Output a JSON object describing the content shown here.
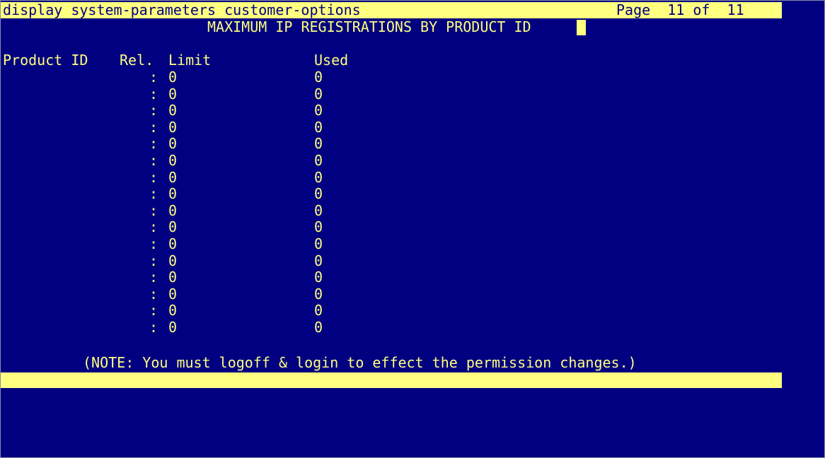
{
  "header": {
    "command": "display system-parameters customer-options",
    "page_label": "Page  11 of  11"
  },
  "form": {
    "title": "MAXIMUM IP REGISTRATIONS BY PRODUCT ID",
    "columns": {
      "product_id": "Product ID",
      "rel": "Rel.",
      "limit": "Limit",
      "used": "Used"
    },
    "separator": ":",
    "rows": [
      {
        "limit": "0",
        "used": "0"
      },
      {
        "limit": "0",
        "used": "0"
      },
      {
        "limit": "0",
        "used": "0"
      },
      {
        "limit": "0",
        "used": "0"
      },
      {
        "limit": "0",
        "used": "0"
      },
      {
        "limit": "0",
        "used": "0"
      },
      {
        "limit": "0",
        "used": "0"
      },
      {
        "limit": "0",
        "used": "0"
      },
      {
        "limit": "0",
        "used": "0"
      },
      {
        "limit": "0",
        "used": "0"
      },
      {
        "limit": "0",
        "used": "0"
      },
      {
        "limit": "0",
        "used": "0"
      },
      {
        "limit": "0",
        "used": "0"
      },
      {
        "limit": "0",
        "used": "0"
      },
      {
        "limit": "0",
        "used": "0"
      },
      {
        "limit": "0",
        "used": "0"
      }
    ],
    "note": "(NOTE: You must logoff & login to effect the permission changes.)"
  },
  "colors": {
    "background": "#010080",
    "foreground": "#ffff80"
  }
}
